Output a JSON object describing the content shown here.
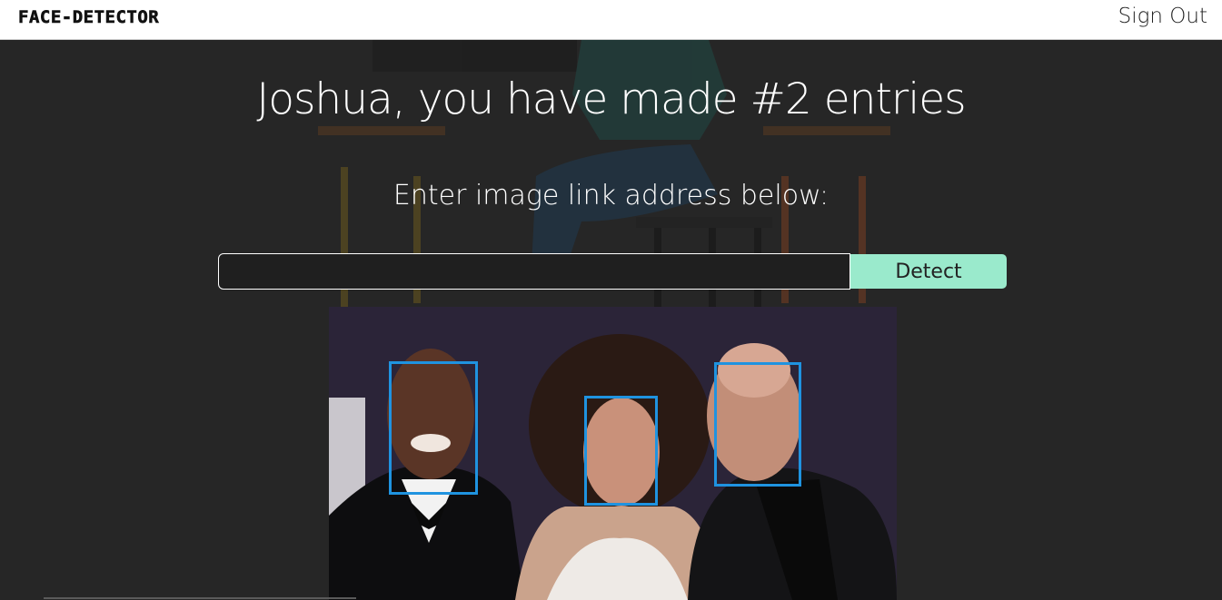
{
  "app": {
    "logo_text": "FACE-DETECTOR",
    "signout_label": "Sign Out"
  },
  "main": {
    "headline": "Joshua, you have made #2 entries",
    "instruction": "Enter image link address below:",
    "input": {
      "value": "",
      "placeholder": ""
    },
    "detect_label": "Detect"
  },
  "detection": {
    "box_color": "#1f93e0",
    "face_count": 3,
    "faces": [
      "face-box-left",
      "face-box-middle",
      "face-box-right"
    ]
  },
  "colors": {
    "background": "#262626",
    "navbar": "#ffffff",
    "detect_button": "#9aeacc"
  }
}
